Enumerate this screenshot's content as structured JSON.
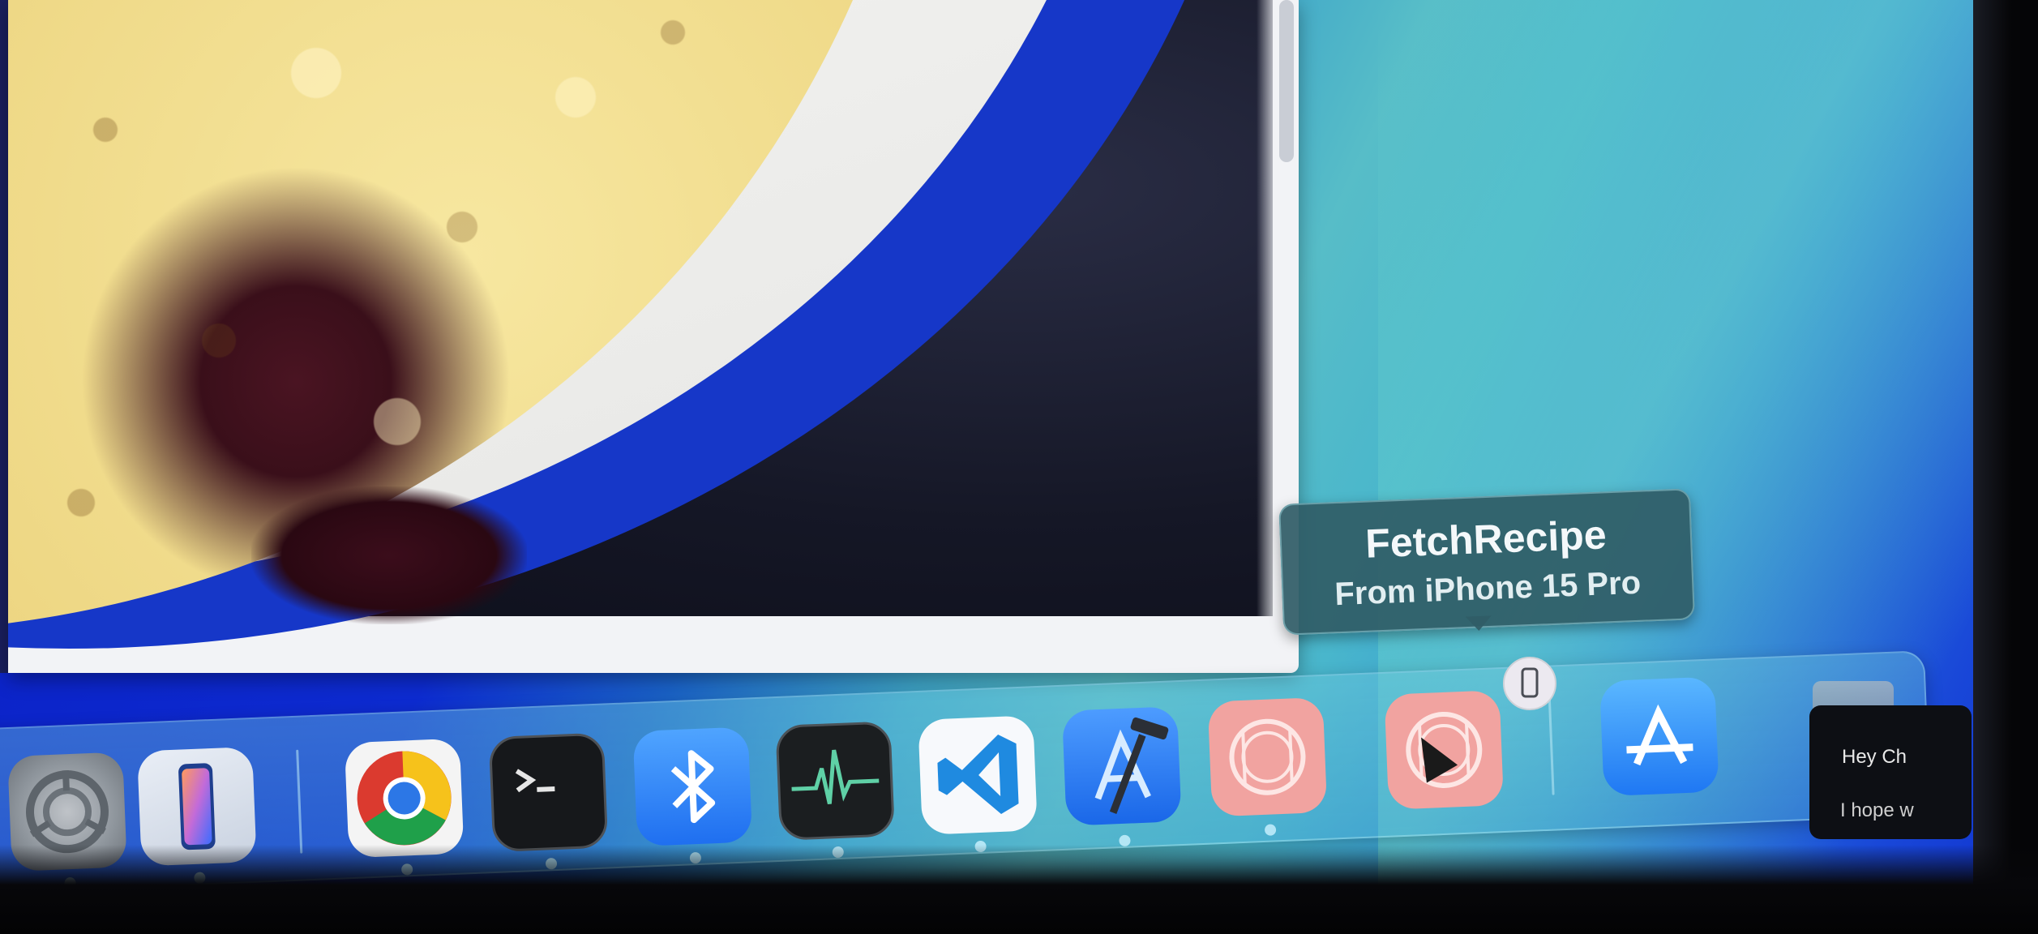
{
  "tooltip": {
    "title": "FetchRecipe",
    "subtitle": "From iPhone 15 Pro"
  },
  "dock": {
    "items": [
      {
        "name": "System Settings",
        "icon": "settings-gear-icon",
        "running": true
      },
      {
        "name": "iPhone Mirroring",
        "icon": "iphone-icon",
        "running": true
      },
      {
        "name": "Google Chrome",
        "icon": "chrome-icon",
        "running": true
      },
      {
        "name": "Terminal",
        "icon": "terminal-icon",
        "running": true
      },
      {
        "name": "Bluetooth",
        "icon": "bluetooth-icon",
        "running": true
      },
      {
        "name": "Activity Monitor",
        "icon": "activity-monitor-icon",
        "running": true
      },
      {
        "name": "Visual Studio Code",
        "icon": "vscode-icon",
        "running": true
      },
      {
        "name": "Xcode",
        "icon": "xcode-hammer-icon",
        "running": true
      },
      {
        "name": "FetchRecipe",
        "icon": "recipe-plate-icon",
        "running": true
      },
      {
        "name": "FetchRecipe (iPhone)",
        "icon": "recipe-plate-icon",
        "running": false
      },
      {
        "name": "App Store",
        "icon": "app-store-icon",
        "running": false
      }
    ]
  },
  "notification": {
    "line1": "Hey Ch",
    "line2": "I hope w"
  },
  "colors": {
    "dock_tint": "#58b8d2",
    "tooltip_bg": "#305c66",
    "recipe_icon": "#f1a3a0",
    "dish_rim": "#1637c8"
  }
}
